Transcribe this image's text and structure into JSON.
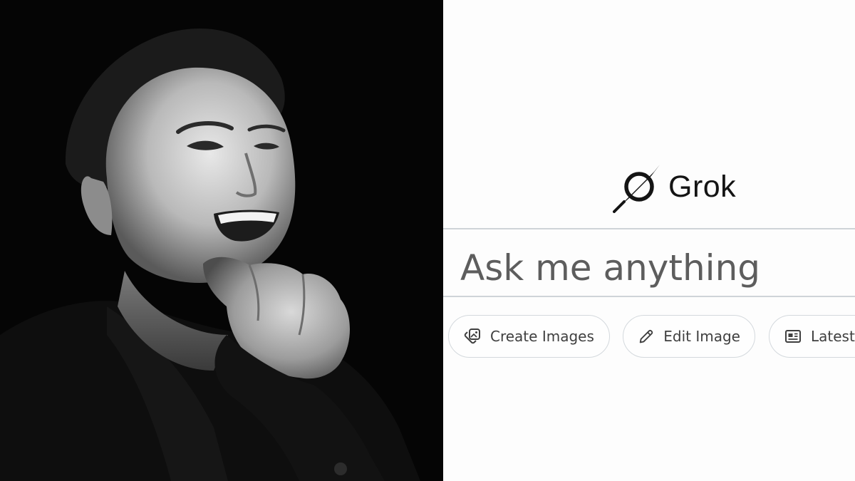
{
  "brand": {
    "name": "Grok",
    "logo_icon": "grok-slash-circle-icon"
  },
  "prompt": {
    "placeholder": "Ask me anything"
  },
  "quick_actions": [
    {
      "label": "Create Images",
      "icon": "create-images-icon"
    },
    {
      "label": "Edit Image",
      "icon": "pencil-icon"
    },
    {
      "label": "Latest",
      "icon": "newspaper-icon"
    }
  ],
  "colors": {
    "photo_background": "#050505",
    "panel_background": "#fdfdfd",
    "divider": "#cfd4d8",
    "placeholder_text": "#5d5d5d",
    "chip_border": "#d4d9dd",
    "brand_text": "#141414"
  }
}
